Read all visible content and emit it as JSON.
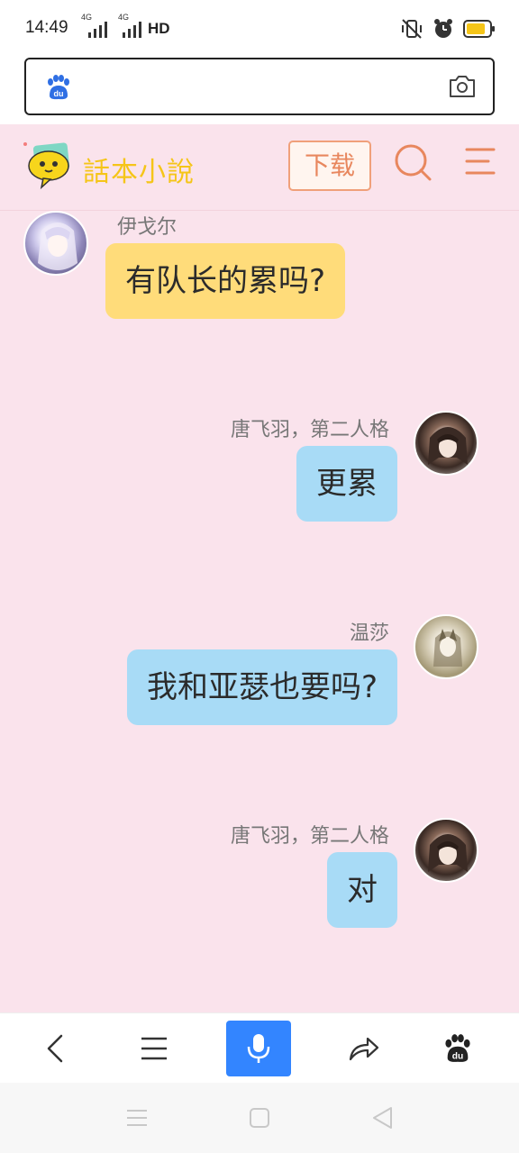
{
  "status_bar": {
    "time": "14:49",
    "network_1": "4G",
    "network_2": "4G",
    "hd": "HD",
    "icons": [
      "vibrate-off-icon",
      "alarm-icon",
      "battery-icon"
    ],
    "battery_color": "#f5c518"
  },
  "address_bar": {
    "left_icon": "baidu-paw-icon",
    "left_icon_text": "du",
    "right_icon": "camera-icon"
  },
  "header": {
    "logo_text": "話本小說",
    "download_label": "下载",
    "search_icon": "search-icon",
    "menu_icon": "hamburger-menu-icon",
    "accent_color": "#e8875e"
  },
  "messages": [
    {
      "sender": "伊戈尔",
      "text": "有队长的累吗?",
      "side": "left",
      "color": "#ffdc7a"
    },
    {
      "sender": "唐飞羽，第二人格",
      "text": "更累",
      "side": "right",
      "color": "#a8dbf6"
    },
    {
      "sender": "温莎",
      "text": "我和亚瑟也要吗?",
      "side": "right",
      "color": "#a8dbf6"
    },
    {
      "sender": "唐飞羽，第二人格",
      "text": "对",
      "side": "right",
      "color": "#a8dbf6"
    }
  ],
  "toolbar": {
    "items": [
      "back-icon",
      "menu-icon",
      "microphone-icon",
      "share-icon",
      "baidu-paw-icon"
    ],
    "baidu_text": "du",
    "mic_color": "#3385ff"
  },
  "navbar": {
    "items": [
      "recent-apps-icon",
      "home-icon",
      "back-triangle-icon"
    ]
  }
}
